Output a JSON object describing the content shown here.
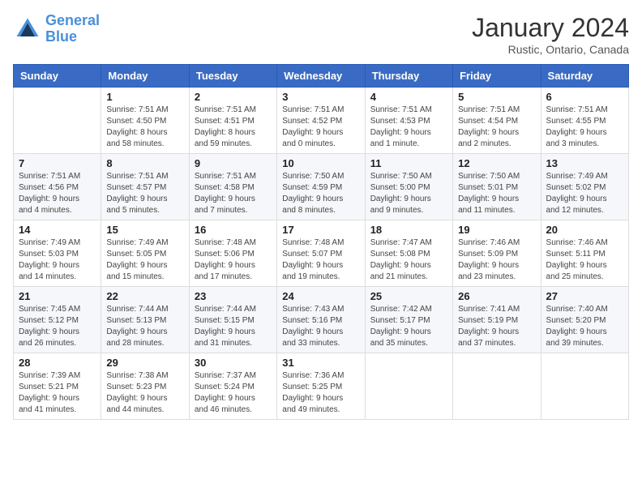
{
  "header": {
    "logo_line1": "General",
    "logo_line2": "Blue",
    "month": "January 2024",
    "location": "Rustic, Ontario, Canada"
  },
  "weekdays": [
    "Sunday",
    "Monday",
    "Tuesday",
    "Wednesday",
    "Thursday",
    "Friday",
    "Saturday"
  ],
  "weeks": [
    [
      {
        "day": "",
        "info": ""
      },
      {
        "day": "1",
        "info": "Sunrise: 7:51 AM\nSunset: 4:50 PM\nDaylight: 8 hours\nand 58 minutes."
      },
      {
        "day": "2",
        "info": "Sunrise: 7:51 AM\nSunset: 4:51 PM\nDaylight: 8 hours\nand 59 minutes."
      },
      {
        "day": "3",
        "info": "Sunrise: 7:51 AM\nSunset: 4:52 PM\nDaylight: 9 hours\nand 0 minutes."
      },
      {
        "day": "4",
        "info": "Sunrise: 7:51 AM\nSunset: 4:53 PM\nDaylight: 9 hours\nand 1 minute."
      },
      {
        "day": "5",
        "info": "Sunrise: 7:51 AM\nSunset: 4:54 PM\nDaylight: 9 hours\nand 2 minutes."
      },
      {
        "day": "6",
        "info": "Sunrise: 7:51 AM\nSunset: 4:55 PM\nDaylight: 9 hours\nand 3 minutes."
      }
    ],
    [
      {
        "day": "7",
        "info": "Sunrise: 7:51 AM\nSunset: 4:56 PM\nDaylight: 9 hours\nand 4 minutes."
      },
      {
        "day": "8",
        "info": "Sunrise: 7:51 AM\nSunset: 4:57 PM\nDaylight: 9 hours\nand 5 minutes."
      },
      {
        "day": "9",
        "info": "Sunrise: 7:51 AM\nSunset: 4:58 PM\nDaylight: 9 hours\nand 7 minutes."
      },
      {
        "day": "10",
        "info": "Sunrise: 7:50 AM\nSunset: 4:59 PM\nDaylight: 9 hours\nand 8 minutes."
      },
      {
        "day": "11",
        "info": "Sunrise: 7:50 AM\nSunset: 5:00 PM\nDaylight: 9 hours\nand 9 minutes."
      },
      {
        "day": "12",
        "info": "Sunrise: 7:50 AM\nSunset: 5:01 PM\nDaylight: 9 hours\nand 11 minutes."
      },
      {
        "day": "13",
        "info": "Sunrise: 7:49 AM\nSunset: 5:02 PM\nDaylight: 9 hours\nand 12 minutes."
      }
    ],
    [
      {
        "day": "14",
        "info": "Sunrise: 7:49 AM\nSunset: 5:03 PM\nDaylight: 9 hours\nand 14 minutes."
      },
      {
        "day": "15",
        "info": "Sunrise: 7:49 AM\nSunset: 5:05 PM\nDaylight: 9 hours\nand 15 minutes."
      },
      {
        "day": "16",
        "info": "Sunrise: 7:48 AM\nSunset: 5:06 PM\nDaylight: 9 hours\nand 17 minutes."
      },
      {
        "day": "17",
        "info": "Sunrise: 7:48 AM\nSunset: 5:07 PM\nDaylight: 9 hours\nand 19 minutes."
      },
      {
        "day": "18",
        "info": "Sunrise: 7:47 AM\nSunset: 5:08 PM\nDaylight: 9 hours\nand 21 minutes."
      },
      {
        "day": "19",
        "info": "Sunrise: 7:46 AM\nSunset: 5:09 PM\nDaylight: 9 hours\nand 23 minutes."
      },
      {
        "day": "20",
        "info": "Sunrise: 7:46 AM\nSunset: 5:11 PM\nDaylight: 9 hours\nand 25 minutes."
      }
    ],
    [
      {
        "day": "21",
        "info": "Sunrise: 7:45 AM\nSunset: 5:12 PM\nDaylight: 9 hours\nand 26 minutes."
      },
      {
        "day": "22",
        "info": "Sunrise: 7:44 AM\nSunset: 5:13 PM\nDaylight: 9 hours\nand 28 minutes."
      },
      {
        "day": "23",
        "info": "Sunrise: 7:44 AM\nSunset: 5:15 PM\nDaylight: 9 hours\nand 31 minutes."
      },
      {
        "day": "24",
        "info": "Sunrise: 7:43 AM\nSunset: 5:16 PM\nDaylight: 9 hours\nand 33 minutes."
      },
      {
        "day": "25",
        "info": "Sunrise: 7:42 AM\nSunset: 5:17 PM\nDaylight: 9 hours\nand 35 minutes."
      },
      {
        "day": "26",
        "info": "Sunrise: 7:41 AM\nSunset: 5:19 PM\nDaylight: 9 hours\nand 37 minutes."
      },
      {
        "day": "27",
        "info": "Sunrise: 7:40 AM\nSunset: 5:20 PM\nDaylight: 9 hours\nand 39 minutes."
      }
    ],
    [
      {
        "day": "28",
        "info": "Sunrise: 7:39 AM\nSunset: 5:21 PM\nDaylight: 9 hours\nand 41 minutes."
      },
      {
        "day": "29",
        "info": "Sunrise: 7:38 AM\nSunset: 5:23 PM\nDaylight: 9 hours\nand 44 minutes."
      },
      {
        "day": "30",
        "info": "Sunrise: 7:37 AM\nSunset: 5:24 PM\nDaylight: 9 hours\nand 46 minutes."
      },
      {
        "day": "31",
        "info": "Sunrise: 7:36 AM\nSunset: 5:25 PM\nDaylight: 9 hours\nand 49 minutes."
      },
      {
        "day": "",
        "info": ""
      },
      {
        "day": "",
        "info": ""
      },
      {
        "day": "",
        "info": ""
      }
    ]
  ]
}
